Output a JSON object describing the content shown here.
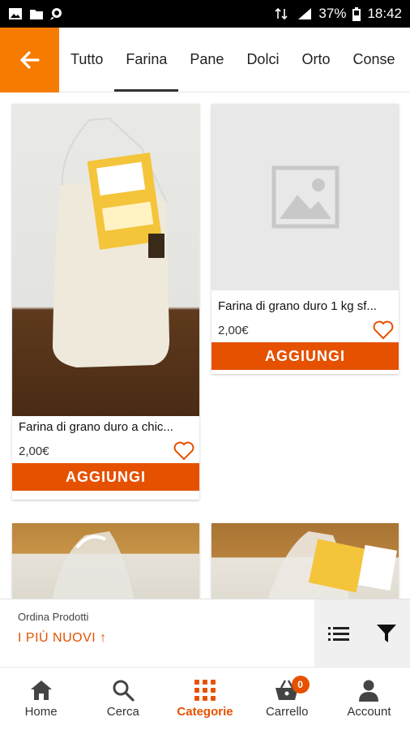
{
  "status_bar": {
    "battery": "37%",
    "time": "18:42",
    "left_icons": [
      "image-icon",
      "folder-icon",
      "chat-search-icon"
    ],
    "right_icons": [
      "data-arrows-icon",
      "signal-icon",
      "battery-icon"
    ]
  },
  "header": {
    "back_icon": "arrow-left-icon",
    "tabs": [
      "Tutto",
      "Farina",
      "Pane",
      "Dolci",
      "Orto",
      "Conse"
    ],
    "active_tab": "Farina"
  },
  "products": [
    {
      "name": "Farina di grano duro a chic...",
      "price": "2,00€",
      "button": "AGGIUNGI",
      "image": "flour-bag-photo",
      "favorite_icon": "heart-outline-icon"
    },
    {
      "name": "Farina di grano duro 1 kg sf...",
      "price": "2,00€",
      "button": "AGGIUNGI",
      "image": "image-placeholder-icon",
      "favorite_icon": "heart-outline-icon"
    },
    {
      "image": "flour-bag-photo"
    },
    {
      "image": "flour-bag-photo"
    }
  ],
  "sort": {
    "label": "Ordina Prodotti",
    "value": "I PIÙ NUOVI ↑",
    "list_icon": "list-view-icon",
    "filter_icon": "filter-icon"
  },
  "bottom_nav": {
    "items": [
      {
        "label": "Home",
        "icon": "home-icon"
      },
      {
        "label": "Cerca",
        "icon": "search-icon"
      },
      {
        "label": "Categorie",
        "icon": "grid-dots-icon"
      },
      {
        "label": "Carrello",
        "icon": "basket-icon"
      },
      {
        "label": "Account",
        "icon": "person-icon"
      }
    ],
    "active": "Categorie",
    "cart_count": "0"
  },
  "colors": {
    "accent": "#e65100",
    "header_orange": "#f57c00",
    "placeholder_bg": "#e8e8e8"
  }
}
